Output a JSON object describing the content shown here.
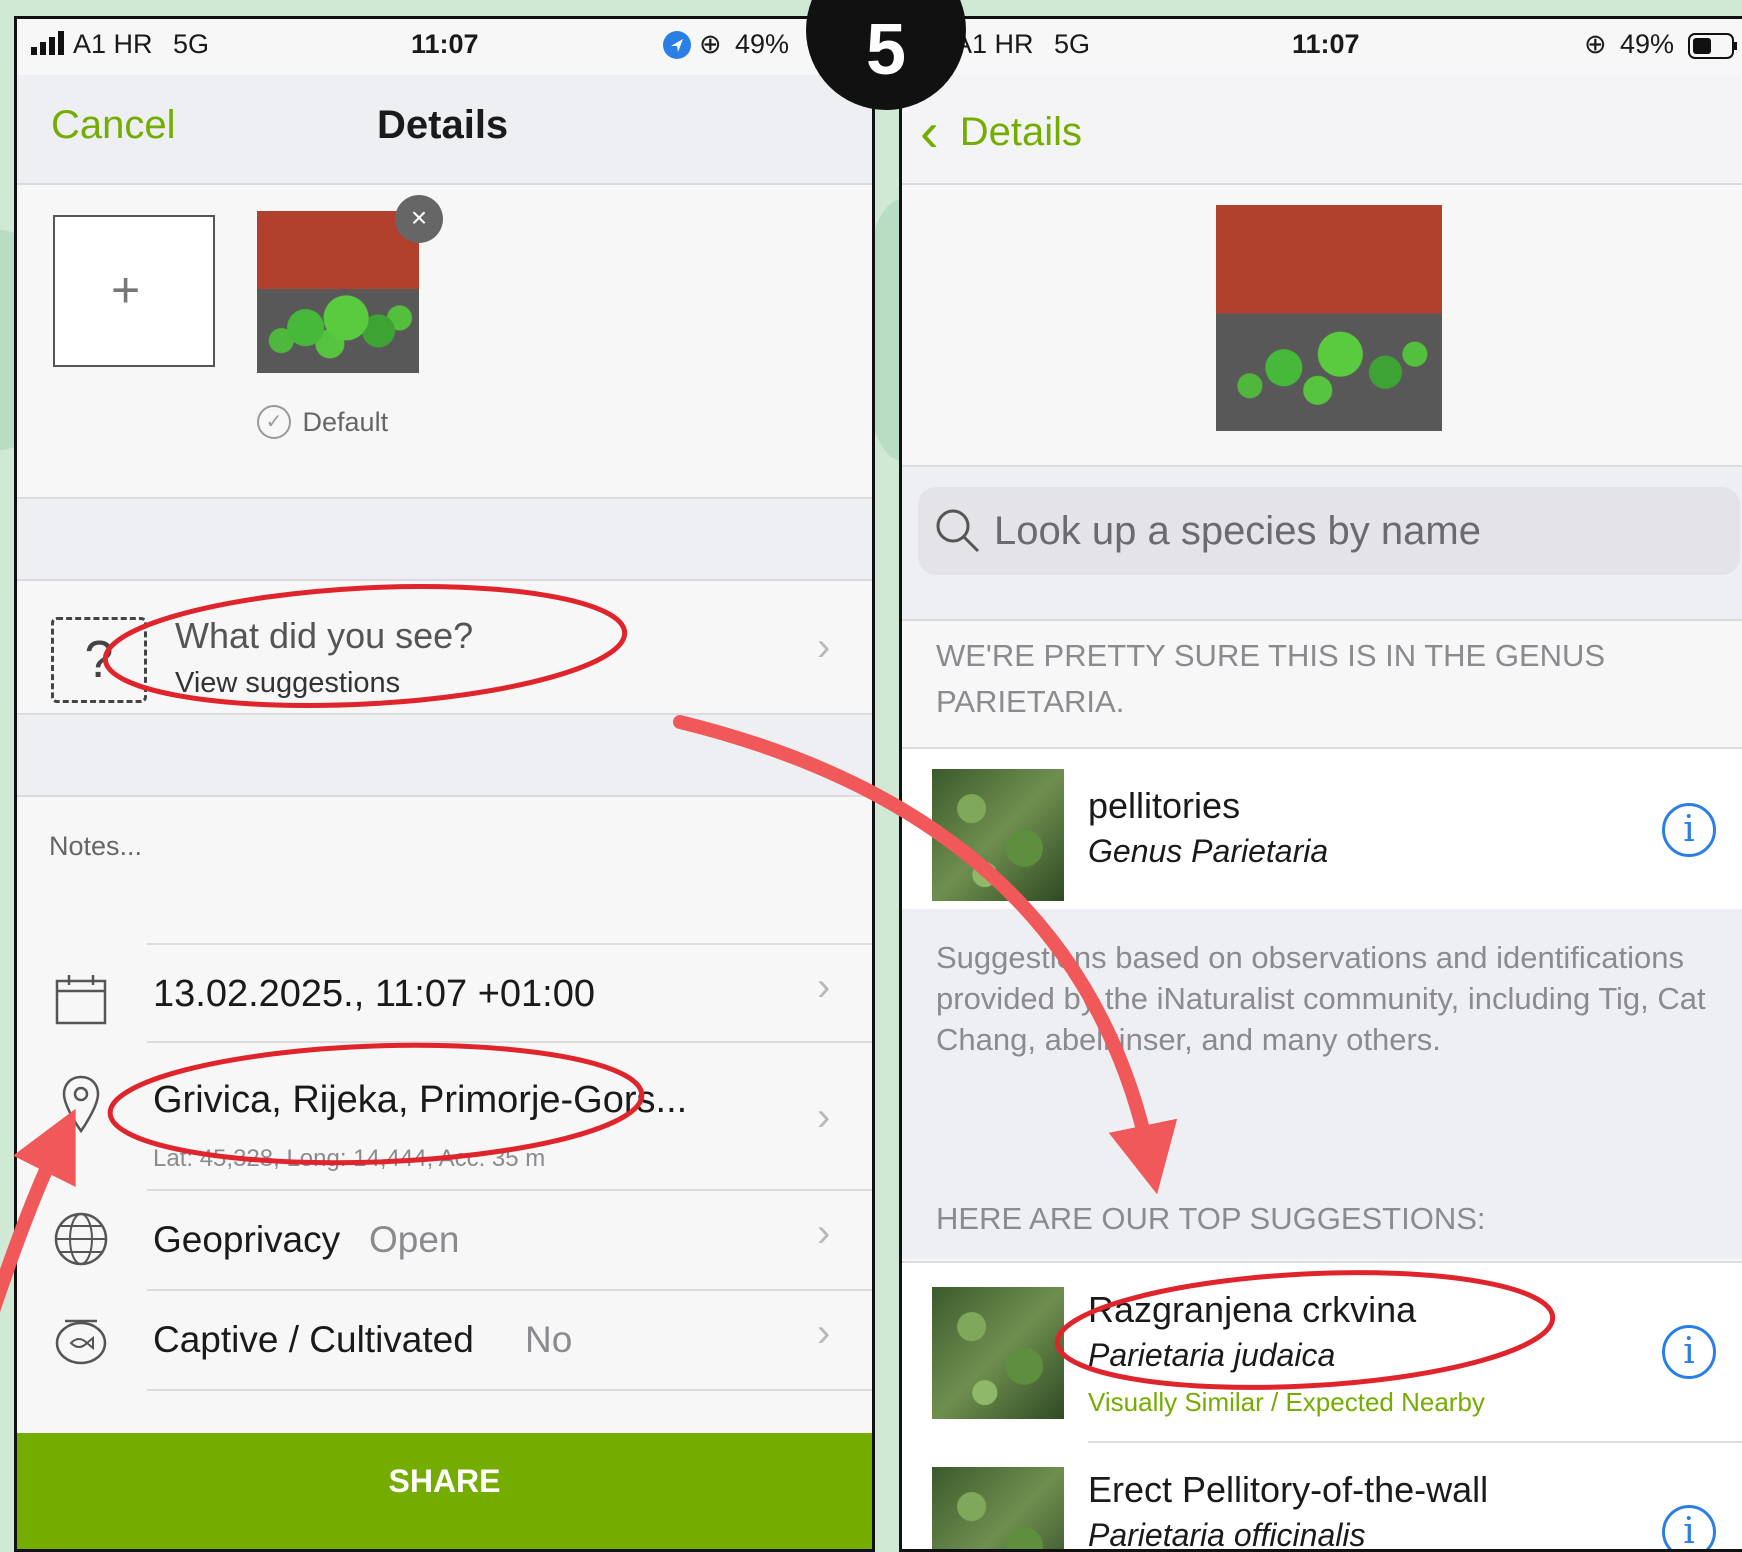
{
  "step_badge": "5",
  "left": {
    "status": {
      "carrier": "A1 HR",
      "network": "5G",
      "time": "11:07",
      "battery": "49%"
    },
    "nav": {
      "cancel": "Cancel",
      "title": "Details"
    },
    "add_photo_label": "+",
    "remove_photo_label": "×",
    "default_label": "Default",
    "identify": {
      "title": "What did you see?",
      "subtitle": "View suggestions"
    },
    "notes_placeholder": "Notes...",
    "date": "13.02.2025., 11:07 +01:00",
    "location": {
      "name": "Grivica, Rijeka, Primorje-Gors...",
      "coords": "Lat: 45,328, Long: 14,444, Acc: 35 m"
    },
    "geoprivacy": {
      "label": "Geoprivacy",
      "value": "Open"
    },
    "captive": {
      "label": "Captive / Cultivated",
      "value": "No"
    },
    "share_button": "SHARE"
  },
  "right": {
    "status": {
      "carrier": "A1 HR",
      "network": "5G",
      "time": "11:07",
      "battery": "49%"
    },
    "nav": {
      "back": "Details"
    },
    "search": {
      "placeholder": "Look up a species by name"
    },
    "genus_header": "WE'RE PRETTY SURE THIS IS IN THE GENUS PARIETARIA.",
    "genus_result": {
      "common": "pellitories",
      "scientific": "Genus Parietaria"
    },
    "disclaimer": "Suggestions based on observations and identifications provided by the iNaturalist community, including Tig, Cat Chang, abelkinser, and many others.",
    "top_header": "HERE ARE OUR TOP SUGGESTIONS:",
    "suggestions": [
      {
        "common": "Razgranjena crkvina",
        "scientific": "Parietaria judaica",
        "tag": "Visually Similar / Expected Nearby"
      },
      {
        "common": "Erect Pellitory-of-the-wall",
        "scientific": "Parietaria officinalis"
      }
    ]
  },
  "colors": {
    "accent_green": "#74ac00",
    "info_blue": "#2a7ee6",
    "annotation_red": "#e0242b",
    "arrow_red": "#f0585a"
  }
}
